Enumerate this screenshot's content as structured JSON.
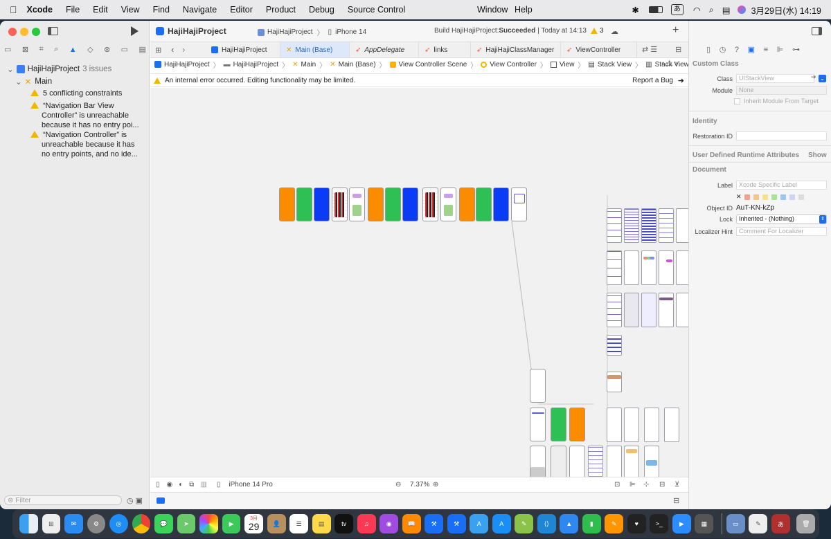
{
  "menubar": {
    "apple": "",
    "app": "Xcode",
    "items": [
      "File",
      "Edit",
      "View",
      "Find",
      "Navigate",
      "Editor",
      "Product",
      "Debug",
      "Source Control",
      "Window",
      "Help"
    ],
    "ime": "あ",
    "date_time": "3月29日(水)  14:19"
  },
  "toolbar": {
    "project": "HajiHajiProject",
    "scheme": "HajiHajiProject",
    "device": "iPhone 14",
    "status_prefix": "Build HajiHajiProject: ",
    "status_result": "Succeeded",
    "status_time": "| Today at 14:13",
    "warnings": "3",
    "add": "+"
  },
  "tabs": [
    "HajiHajiProject",
    "Main (Base)",
    "AppDelegate",
    "links",
    "HajiHajiClassManager",
    "ViewController"
  ],
  "jumpbar": [
    "HajiHajiProject",
    "HajiHajiProject",
    "Main",
    "Main (Base)",
    "View Controller Scene",
    "View Controller",
    "View",
    "Stack View",
    "Stack View"
  ],
  "banner": {
    "message": "An internal error occurred. Editing functionality may be limited.",
    "action": "Report a Bug"
  },
  "navigator": {
    "project": "HajiHajiProject",
    "issues": "3 issues",
    "file": "Main",
    "items": [
      "5 conflicting constraints",
      "“Navigation Bar View Controller” is unreachable because it has no entry poi...",
      "“Navigation Controller” is unreachable because it has no entry points, and no ide..."
    ],
    "filter_placeholder": "Filter"
  },
  "canvas_bar": {
    "device": "iPhone 14 Pro",
    "zoom": "7.37%"
  },
  "inspector": {
    "custom_class": {
      "title": "Custom Class",
      "class_label": "Class",
      "class_value": "UIStackView",
      "module_label": "Module",
      "module_value": "None",
      "inherit": "Inherit Module From Target"
    },
    "identity": {
      "title": "Identity",
      "restoration_label": "Restoration ID"
    },
    "udra": {
      "title": "User Defined Runtime Attributes",
      "show": "Show"
    },
    "document": {
      "title": "Document",
      "label_label": "Label",
      "label_placeholder": "Xcode Specific Label",
      "object_id_label": "Object ID",
      "object_id": "AuT-KN-kZp",
      "lock_label": "Lock",
      "lock_value": "Inherited - (Nothing)",
      "hint_label": "Localizer Hint",
      "hint_placeholder": "Comment For Localizer"
    }
  },
  "dock": {
    "calendar_month": "3月",
    "calendar_day": "29",
    "appletv": "tv"
  },
  "colors": {
    "accent": "#1a6ef5",
    "warning": "#f2b600",
    "orange": "#fb8c00",
    "green": "#2ec055",
    "blue": "#0a3cf5"
  }
}
